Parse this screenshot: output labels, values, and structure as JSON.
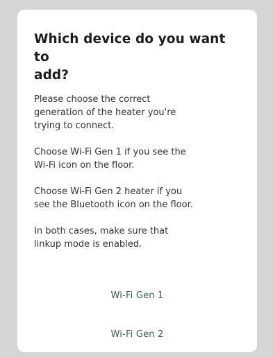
{
  "dialog": {
    "title": "Which device do you want to\nadd?",
    "paragraphs": [
      "Please choose the correct\ngeneration of the heater you're\ntrying to connect.",
      "Choose Wi-Fi Gen 1 if you see the\nWi-Fi icon on the floor.",
      "Choose Wi-Fi Gen 2 heater if you\nsee the Bluetooth icon on the floor.",
      "In both cases, make sure that\nlinkup mode is enabled."
    ],
    "options": [
      {
        "label": "Wi-Fi Gen 1"
      },
      {
        "label": "Wi-Fi Gen 2"
      }
    ]
  },
  "colors": {
    "accent": "#3b5e4c",
    "backdrop": "#d6d6d6",
    "surface": "#ffffff"
  }
}
